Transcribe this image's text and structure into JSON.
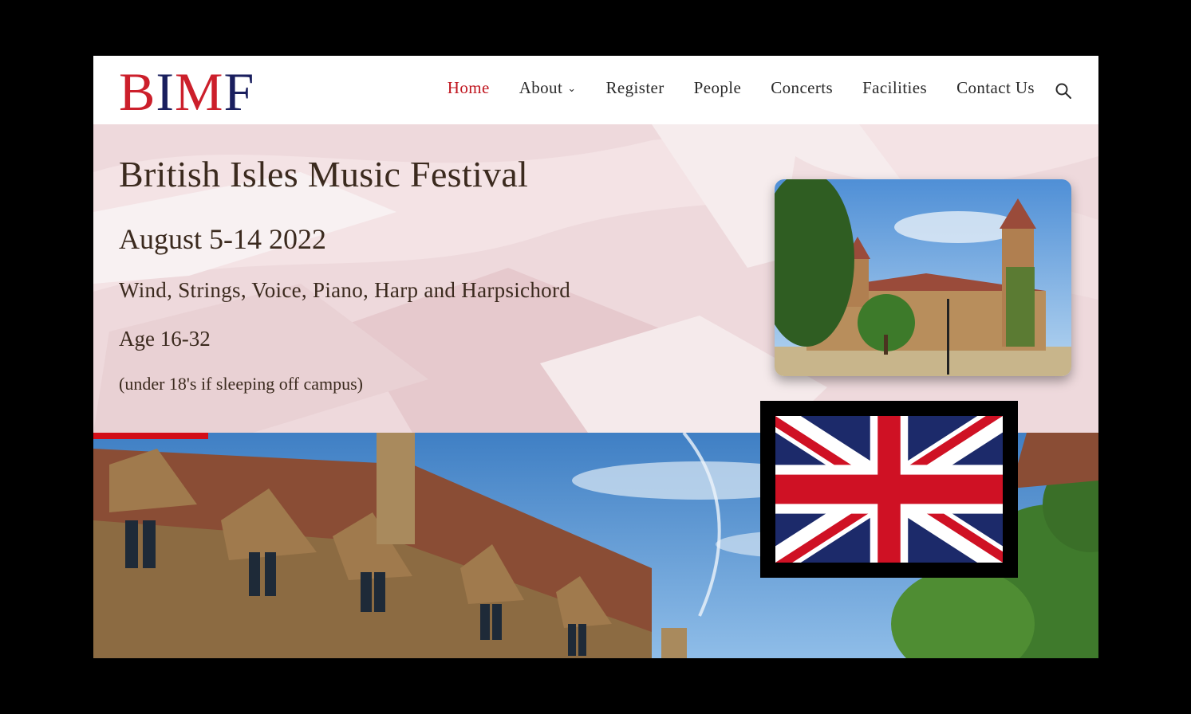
{
  "logo": {
    "letters": [
      "B",
      "I",
      "M",
      "F"
    ]
  },
  "nav": {
    "items": [
      {
        "label": "Home",
        "active": true
      },
      {
        "label": "About",
        "has_dropdown": true
      },
      {
        "label": "Register"
      },
      {
        "label": "People"
      },
      {
        "label": "Concerts"
      },
      {
        "label": "Facilities"
      },
      {
        "label": "Contact Us"
      }
    ],
    "search_icon": "search-icon"
  },
  "hero": {
    "title": "British Isles Music Festival",
    "dates": "August 5-14 2022",
    "instruments": "Wind, Strings, Voice, Piano, Harp and Harpsichord",
    "age": "Age 16-32",
    "note": "(under 18's if sleeping off campus)"
  },
  "colors": {
    "brand_red": "#cc1f2b",
    "brand_navy": "#1a1f5e",
    "active_nav": "#c0161f",
    "accent_bar": "#d20e18"
  }
}
